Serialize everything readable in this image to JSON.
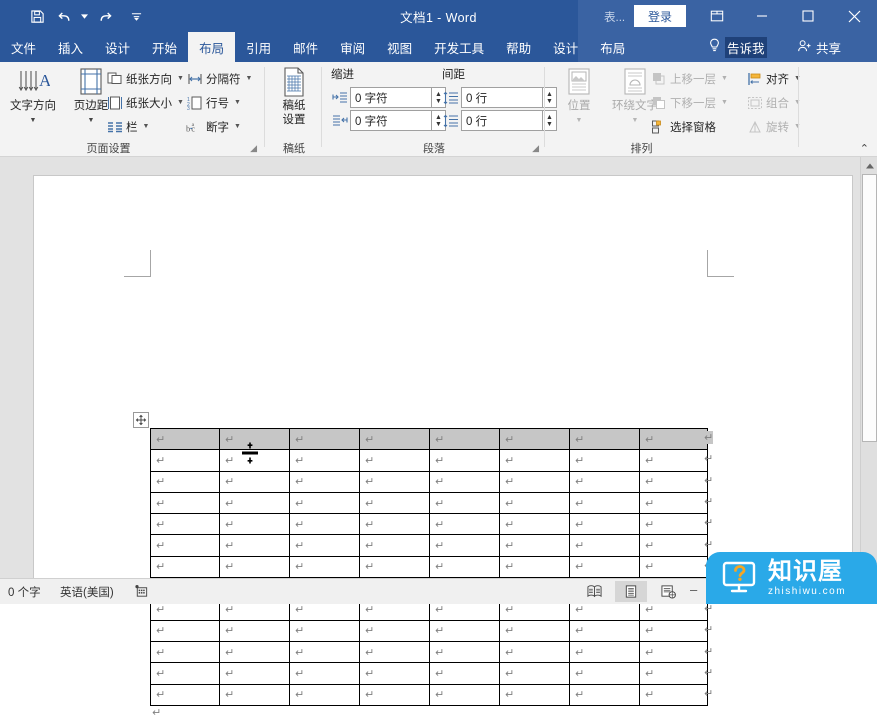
{
  "titlebar": {
    "document_title": "文档1  -  Word",
    "quick_access": [
      {
        "name": "save",
        "icon": "save-icon"
      },
      {
        "name": "undo",
        "icon": "undo-icon"
      },
      {
        "name": "redo",
        "icon": "redo-icon"
      },
      {
        "name": "customize",
        "icon": "chevron-down-icon"
      }
    ],
    "contextual_group_label": "表...",
    "signin_label": "登录",
    "ribbon_display_options": "ribbon-display-options-icon",
    "minimize": "–",
    "maximize": "▢",
    "close": "✕"
  },
  "tabs": [
    {
      "label": "文件",
      "active": false
    },
    {
      "label": "插入",
      "active": false
    },
    {
      "label": "设计",
      "active": false
    },
    {
      "label": "开始",
      "active": false
    },
    {
      "label": "布局",
      "active": true
    },
    {
      "label": "引用",
      "active": false
    },
    {
      "label": "邮件",
      "active": false
    },
    {
      "label": "审阅",
      "active": false
    },
    {
      "label": "视图",
      "active": false
    },
    {
      "label": "开发工具",
      "active": false
    },
    {
      "label": "帮助",
      "active": false
    }
  ],
  "contextual_tabs": [
    {
      "label": "设计",
      "active": false
    },
    {
      "label": "布局",
      "active": false
    }
  ],
  "tellme": {
    "label": "告诉我",
    "icon": "lightbulb-icon"
  },
  "share": {
    "label": "共享",
    "icon": "share-person-icon"
  },
  "ribbon": {
    "groups": [
      {
        "name": "page-setup",
        "title": "页面设置",
        "big_buttons": [
          {
            "label": "文字方向",
            "icon": "text-direction-icon",
            "has_caret": true,
            "disabled": false
          },
          {
            "label": "页边距",
            "icon": "margins-icon",
            "has_caret": true,
            "disabled": false
          }
        ],
        "small_buttons": [
          {
            "label": "纸张方向",
            "icon": "orientation-icon",
            "has_caret": true
          },
          {
            "label": "纸张大小",
            "icon": "paper-size-icon",
            "has_caret": true
          },
          {
            "label": "栏",
            "icon": "columns-icon",
            "has_caret": true
          },
          {
            "label": "分隔符",
            "icon": "breaks-icon",
            "has_caret": true
          },
          {
            "label": "行号",
            "icon": "line-numbers-icon",
            "has_caret": true
          },
          {
            "label": "断字",
            "icon": "hyphenation-icon",
            "has_caret": true
          }
        ]
      },
      {
        "name": "manuscript",
        "title": "稿纸",
        "big_buttons": [
          {
            "label_line1": "稿纸",
            "label_line2": "设置",
            "icon": "manuscript-settings-icon",
            "disabled": false
          }
        ]
      },
      {
        "name": "paragraph",
        "title": "段落",
        "column_headers": [
          "缩进",
          "间距"
        ],
        "fields": [
          {
            "name": "indent-left",
            "icon": "indent-left-icon",
            "value": "0 字符"
          },
          {
            "name": "indent-right",
            "icon": "indent-right-icon",
            "value": "0 字符"
          },
          {
            "name": "spacing-before",
            "icon": "spacing-before-icon",
            "value": "0 行"
          },
          {
            "name": "spacing-after",
            "icon": "spacing-after-icon",
            "value": "0 行"
          }
        ]
      },
      {
        "name": "arrange",
        "title": "排列",
        "big_buttons": [
          {
            "label": "位置",
            "icon": "position-icon",
            "has_caret": true,
            "disabled": true
          },
          {
            "label": "环绕文字",
            "icon": "wrap-text-icon",
            "has_caret": true,
            "disabled": true
          }
        ],
        "small_buttons": [
          {
            "label": "上移一层",
            "icon": "bring-forward-icon",
            "has_caret": true,
            "disabled": true
          },
          {
            "label": "下移一层",
            "icon": "send-backward-icon",
            "has_caret": true,
            "disabled": true
          },
          {
            "label": "选择窗格",
            "icon": "selection-pane-icon",
            "has_caret": false,
            "disabled": false
          },
          {
            "label": "对齐",
            "icon": "align-icon",
            "has_caret": true,
            "disabled": false
          },
          {
            "label": "组合",
            "icon": "group-icon",
            "has_caret": true,
            "disabled": true
          },
          {
            "label": "旋转",
            "icon": "rotate-icon",
            "has_caret": true,
            "disabled": true
          }
        ]
      }
    ],
    "collapse_label": "⌃"
  },
  "document": {
    "table": {
      "rows": 13,
      "columns": 8,
      "selected_row_index": 0,
      "cell_mark": "↵",
      "end_of_row_mark": "↵",
      "after_table_paragraph_mark": "↵",
      "move_handle_icon": "table-move-handle-icon",
      "cursor_icon": "row-resize-cursor"
    }
  },
  "statusbar": {
    "word_count": "0 个字",
    "language": "英语(美国)",
    "proofing_icon": "proofing-icon",
    "views": [
      {
        "name": "read-mode",
        "icon": "read-mode-icon",
        "active": false
      },
      {
        "name": "print-layout",
        "icon": "print-layout-icon",
        "active": true
      },
      {
        "name": "web-layout",
        "icon": "web-layout-icon",
        "active": false
      }
    ],
    "zoom_out": "–"
  },
  "watermark": {
    "cn": "知识屋",
    "en": "zhishiwu.com",
    "icon": "monitor-question-icon",
    "color": "#2aa9e8"
  },
  "colors": {
    "titlebar": "#2b579a",
    "contextual_banner": "#3a63a3",
    "ribbon_bg": "#f3f3f3",
    "doc_bg": "#e2e2e2",
    "selection": "#c6c6c6",
    "accent": "#2b579a"
  }
}
